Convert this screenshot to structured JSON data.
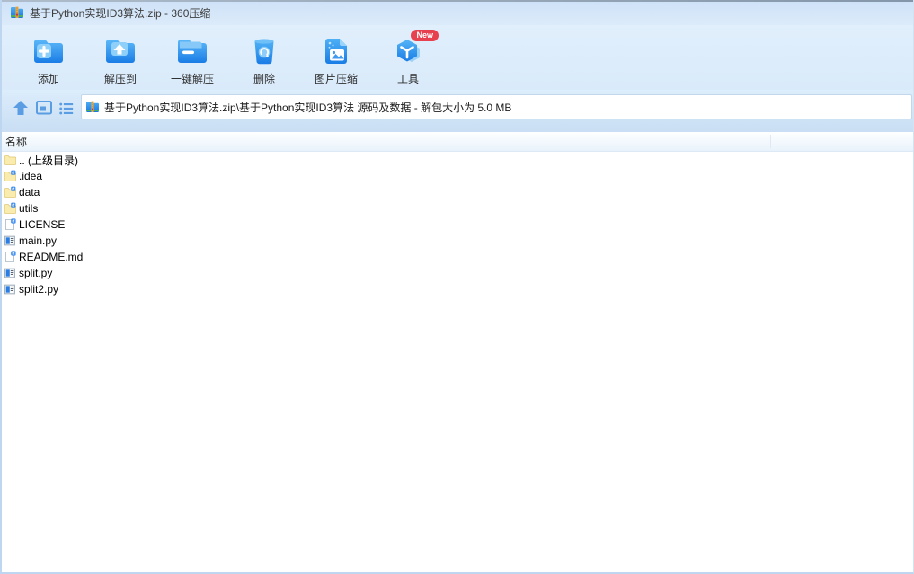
{
  "window": {
    "title": "基于Python实现ID3算法.zip - 360压缩",
    "app_icon": "zip-file-icon"
  },
  "toolbar": {
    "buttons": [
      {
        "id": "add",
        "label": "添加",
        "icon": "add-folder-icon"
      },
      {
        "id": "extract-to",
        "label": "解压到",
        "icon": "extract-to-icon"
      },
      {
        "id": "one-click-extract",
        "label": "一键解压",
        "icon": "one-click-extract-icon"
      },
      {
        "id": "delete",
        "label": "删除",
        "icon": "trash-recycle-icon"
      },
      {
        "id": "image-compress",
        "label": "图片压缩",
        "icon": "image-compress-icon"
      },
      {
        "id": "tools",
        "label": "工具",
        "icon": "tools-cube-icon",
        "badge": "New"
      }
    ]
  },
  "navbar": {
    "up_icon": "up-arrow-icon",
    "panel_icon": "panel-view-icon",
    "list_icon": "list-view-icon",
    "address_icon": "zip-file-icon",
    "address": "基于Python实现ID3算法.zip\\基于Python实现ID3算法 源码及数据 - 解包大小为 5.0 MB"
  },
  "file_list": {
    "columns": [
      {
        "id": "name",
        "label": "名称"
      }
    ],
    "items": [
      {
        "name": ".. (上级目录)",
        "type": "parent-folder"
      },
      {
        "name": ".idea",
        "type": "folder"
      },
      {
        "name": "data",
        "type": "folder"
      },
      {
        "name": "utils",
        "type": "folder"
      },
      {
        "name": "LICENSE",
        "type": "file"
      },
      {
        "name": "main.py",
        "type": "python-file"
      },
      {
        "name": "README.md",
        "type": "file"
      },
      {
        "name": "split.py",
        "type": "python-file"
      },
      {
        "name": "split2.py",
        "type": "python-file"
      }
    ]
  },
  "colors": {
    "accent_blue": "#1a7de6",
    "chrome_top": "#cde1f7",
    "chrome_light": "#e1effc",
    "folder_yellow": "#f9ecae",
    "badge_red": "#e7404f",
    "title_text": "#3d3d3d"
  }
}
